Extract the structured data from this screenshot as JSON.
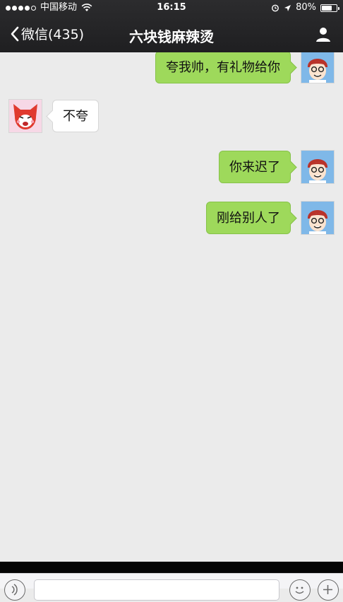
{
  "status_bar": {
    "carrier": "中国移动",
    "time": "16:15",
    "battery": "80%",
    "battery_level": 0.8,
    "signal_bars": 4
  },
  "nav": {
    "back_label": "微信(435)",
    "title": "六块钱麻辣烫"
  },
  "messages": [
    {
      "side": "out",
      "text": "夸我帅，有礼物给你"
    },
    {
      "side": "in",
      "text": "不夸"
    },
    {
      "side": "out",
      "text": "你来迟了"
    },
    {
      "side": "out",
      "text": "刚给别人了"
    }
  ],
  "colors": {
    "outgoing_bubble": "#9ed95b",
    "incoming_bubble": "#ffffff",
    "background": "#ebebeb",
    "header": "#262628"
  },
  "icons": [
    "back-chevron-icon",
    "wifi-icon",
    "alarm-icon",
    "location-arrow-icon",
    "battery-icon",
    "profile-icon",
    "voice-icon",
    "emoji-icon",
    "plus-icon"
  ]
}
